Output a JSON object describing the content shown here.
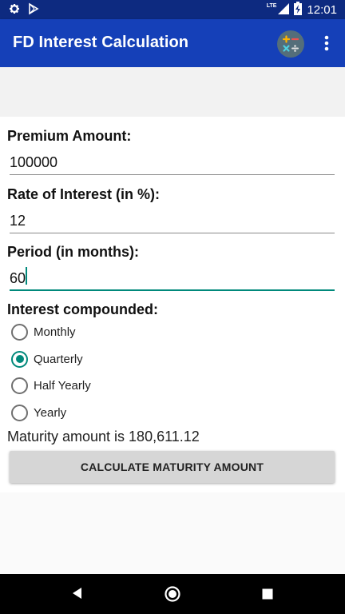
{
  "status_bar": {
    "time": "12:01",
    "network_label": "LTE",
    "icons": [
      "gear-icon",
      "play-store-icon",
      "signal-icon",
      "battery-charging-icon"
    ]
  },
  "app_bar": {
    "title": "FD Interest Calculation",
    "icons": [
      "calculator-icon",
      "overflow-menu-icon"
    ]
  },
  "form": {
    "premium_label": "Premium Amount:",
    "premium_value": "100000",
    "rate_label": "Rate of Interest (in %):",
    "rate_value": "12",
    "period_label": "Period (in months):",
    "period_value": "60",
    "compound_label": "Interest compounded:",
    "compound_options": [
      "Monthly",
      "Quarterly",
      "Half Yearly",
      "Yearly"
    ],
    "selected_option": "Quarterly"
  },
  "result_text": "Maturity amount is 180,611.12",
  "calculate_button_label": "CALCULATE MATURITY AMOUNT",
  "nav_bar": {
    "icons": [
      "back-icon",
      "home-icon",
      "recents-icon"
    ]
  },
  "colors": {
    "app_bar": "#1540b8",
    "status_bar": "#0d2a80",
    "accent": "#00897b"
  }
}
